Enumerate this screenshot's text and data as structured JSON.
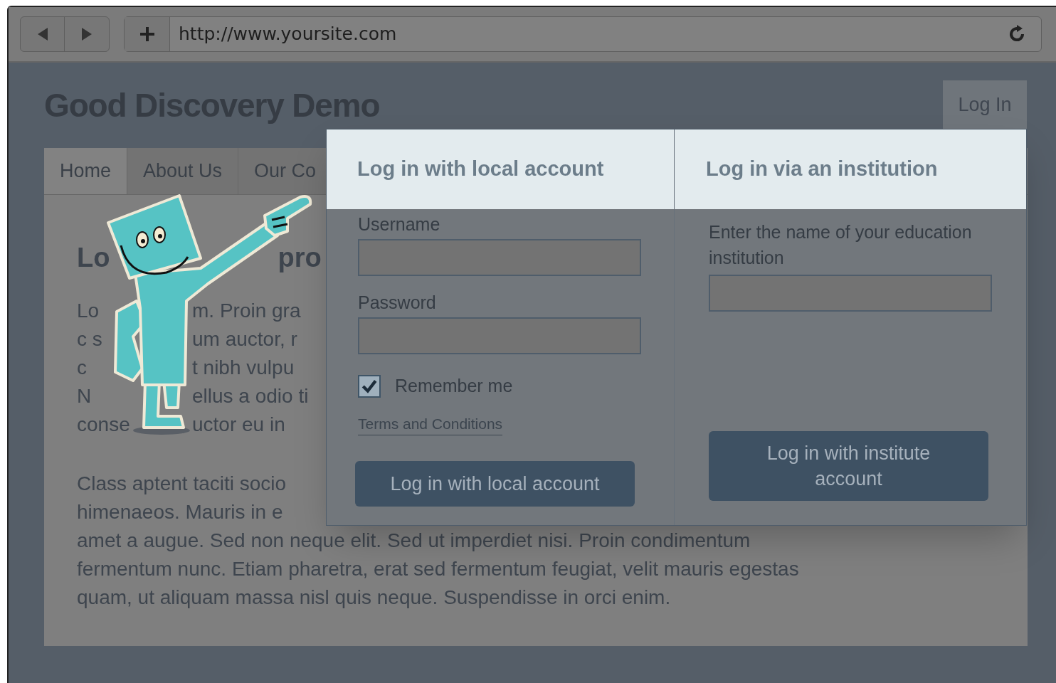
{
  "browser": {
    "url": "http://www.yoursite.com"
  },
  "site": {
    "title": "Good Discovery Demo",
    "login_tab": "Log In"
  },
  "nav": {
    "tabs": [
      {
        "label": "Home",
        "selected": true
      },
      {
        "label": "About Us",
        "selected": false
      },
      {
        "label": "Our Co",
        "selected": false
      }
    ]
  },
  "article": {
    "heading": [
      "Lo",
      "pro"
    ],
    "lines": [
      {
        "left": "Lo",
        "right": "m. Proin gra"
      },
      {
        "left": "c s",
        "right": "um auctor, r"
      },
      {
        "left": "c",
        "right": "t nibh vulpu"
      },
      {
        "left": "N",
        "right": "ellus a odio ti"
      },
      {
        "left": "conse",
        "right": "uctor eu in"
      }
    ],
    "paragraph_2": [
      "Class aptent taciti socio",
      "himenaeos. Mauris in e",
      "amet a augue. Sed non neque elit. Sed ut imperdiet nisi. Proin condimentum",
      "fermentum nunc. Etiam pharetra, erat sed fermentum feugiat, velit mauris egestas",
      "quam, ut aliquam massa nisl quis neque. Suspendisse in orci enim."
    ]
  },
  "login": {
    "local": {
      "title": "Log in with local account",
      "username_label": "Username",
      "password_label": "Password",
      "remember": {
        "label": "Remember me",
        "checked": true
      },
      "terms_link": "Terms and Conditions",
      "button": "Log in with local account"
    },
    "institution": {
      "title": "Log in via an institution",
      "field_label": "Enter the name of your education institution",
      "button": "Log in with institute account"
    }
  }
}
